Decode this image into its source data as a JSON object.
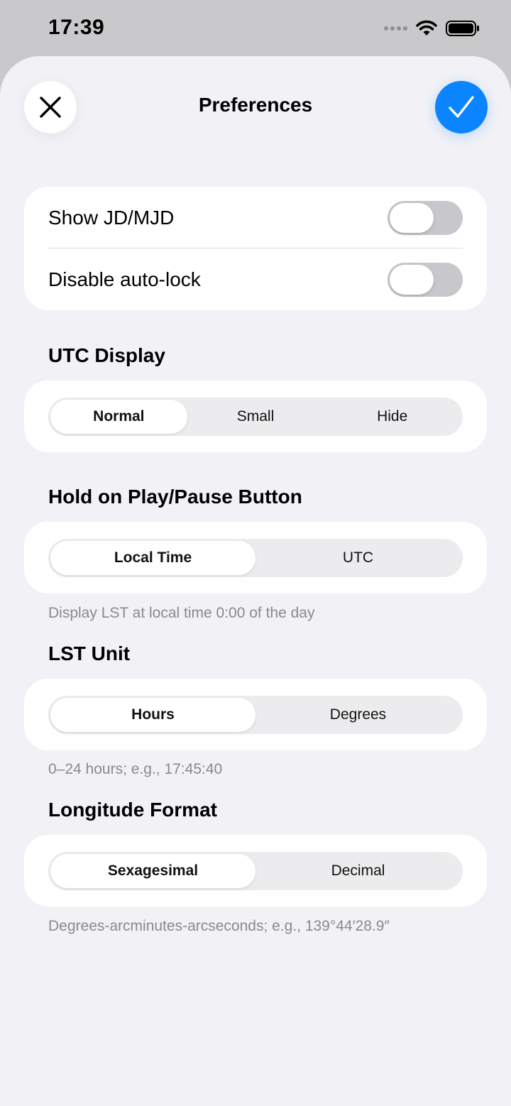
{
  "status_bar": {
    "time": "17:39"
  },
  "header": {
    "title": "Preferences"
  },
  "toggles": [
    {
      "label": "Show JD/MJD",
      "on": false
    },
    {
      "label": "Disable auto-lock",
      "on": false
    }
  ],
  "utc_display": {
    "header": "UTC Display",
    "options": [
      "Normal",
      "Small",
      "Hide"
    ],
    "selected": "Normal"
  },
  "hold_play_pause": {
    "header": "Hold on Play/Pause Button",
    "options": [
      "Local Time",
      "UTC"
    ],
    "selected": "Local Time",
    "footnote": "Display LST at local time 0:00 of the day"
  },
  "lst_unit": {
    "header": "LST Unit",
    "options": [
      "Hours",
      "Degrees"
    ],
    "selected": "Hours",
    "footnote": "0–24 hours; e.g., 17:45:40"
  },
  "longitude_format": {
    "header": "Longitude Format",
    "options": [
      "Sexagesimal",
      "Decimal"
    ],
    "selected": "Sexagesimal",
    "footnote": "Degrees-arcminutes-arcseconds; e.g., 139°44′28.9″"
  },
  "colors": {
    "accent": "#0a84ff",
    "background": "#f2f2f6",
    "toggle_off": "#c7c7cc"
  }
}
